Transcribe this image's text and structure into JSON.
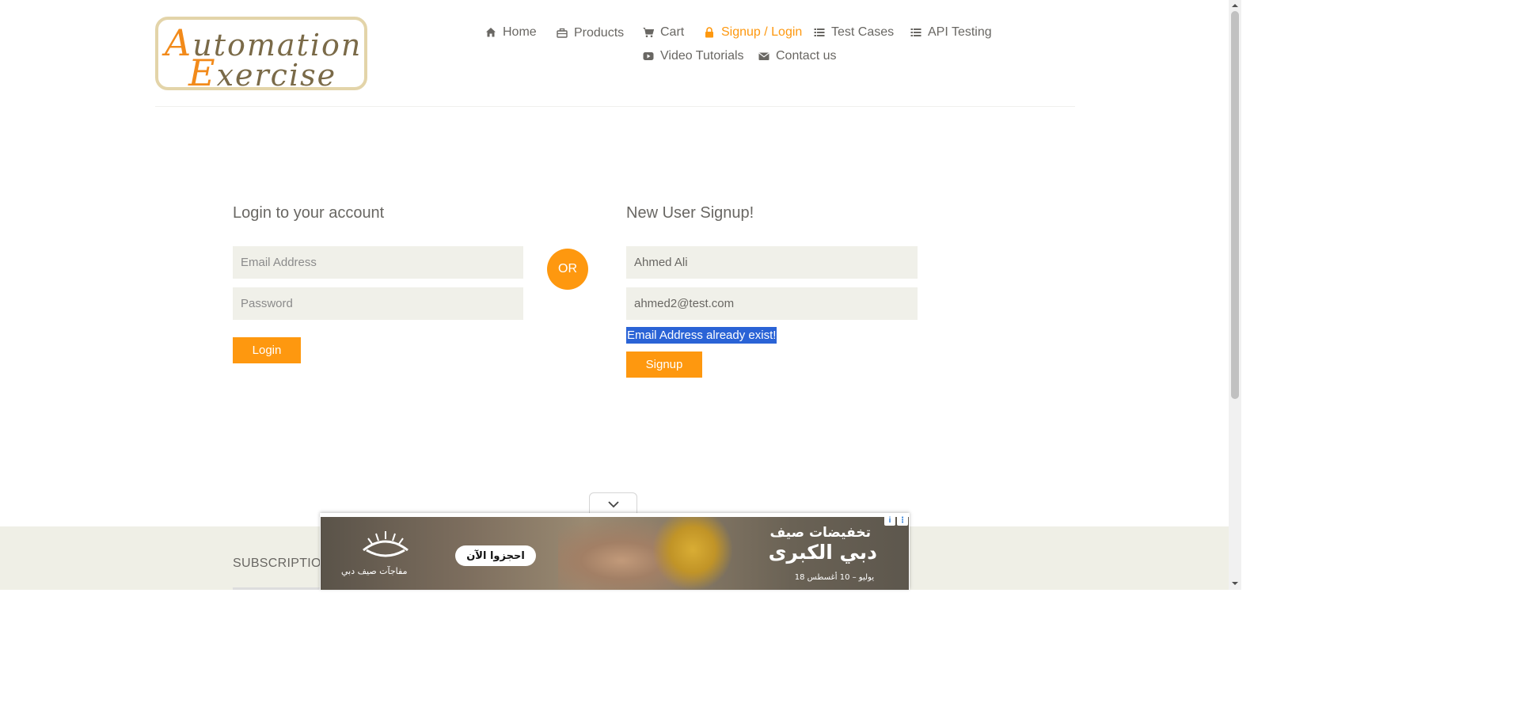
{
  "logo": {
    "alt": "Automation Exercise",
    "line1_cap": "A",
    "line1_rest": "utomation",
    "line2_cap": "E",
    "line2_rest": "xercise"
  },
  "nav": {
    "items": [
      {
        "label": "Home",
        "icon": "home-icon"
      },
      {
        "label": "Products",
        "icon": "briefcase-icon"
      },
      {
        "label": "Cart",
        "icon": "cart-icon"
      },
      {
        "label": "Signup / Login",
        "icon": "lock-icon",
        "active": true
      },
      {
        "label": "Test Cases",
        "icon": "list-icon"
      },
      {
        "label": "API Testing",
        "icon": "list-icon"
      },
      {
        "label": "Video Tutorials",
        "icon": "youtube-play-icon"
      },
      {
        "label": "Contact us",
        "icon": "envelope-icon"
      }
    ]
  },
  "login": {
    "title": "Login to your account",
    "email_placeholder": "Email Address",
    "password_placeholder": "Password",
    "button": "Login"
  },
  "or_label": "OR",
  "signup": {
    "title": "New User Signup!",
    "name_value": "Ahmed Ali",
    "email_value": "ahmed2@test.com",
    "error": "Email Address already exist!",
    "button": "Signup"
  },
  "footer": {
    "subscription_title": "SUBSCRIPTIO"
  },
  "ad": {
    "cta": "احجزوا الآن",
    "headline_small": "تخفيضات صيف",
    "headline_big": "دبي الكبرى",
    "dates": "18 يوليو – 10 أغسطس",
    "brand": "مفاجآت صيف دبي"
  },
  "colors": {
    "accent": "#fe980f",
    "field_bg": "#f0f0e9",
    "text": "#696763",
    "selection": "#2a63d6"
  }
}
